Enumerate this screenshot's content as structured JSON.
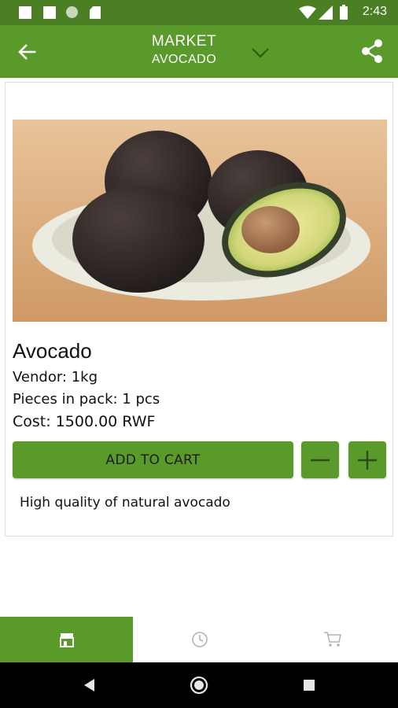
{
  "status_bar": {
    "time": "2:43"
  },
  "app_bar": {
    "title": "MARKET",
    "subtitle": "AVOCADO"
  },
  "product": {
    "name": "Avocado",
    "vendor": "Vendor: 1kg",
    "pieces": "Pieces in pack: 1 pcs",
    "cost": "Cost: 1500.00 RWF",
    "add_to_cart_label": "ADD TO CART",
    "description": "High quality of natural avocado"
  },
  "icons": {
    "back": "arrow-left-icon",
    "dropdown": "chevron-down-icon",
    "share": "share-icon",
    "minus": "minus-icon",
    "plus": "plus-icon",
    "market": "store-icon",
    "history": "clock-icon",
    "cart": "cart-icon"
  },
  "colors": {
    "primary": "#5a9a2a",
    "primary_dark": "#4b7f24"
  }
}
